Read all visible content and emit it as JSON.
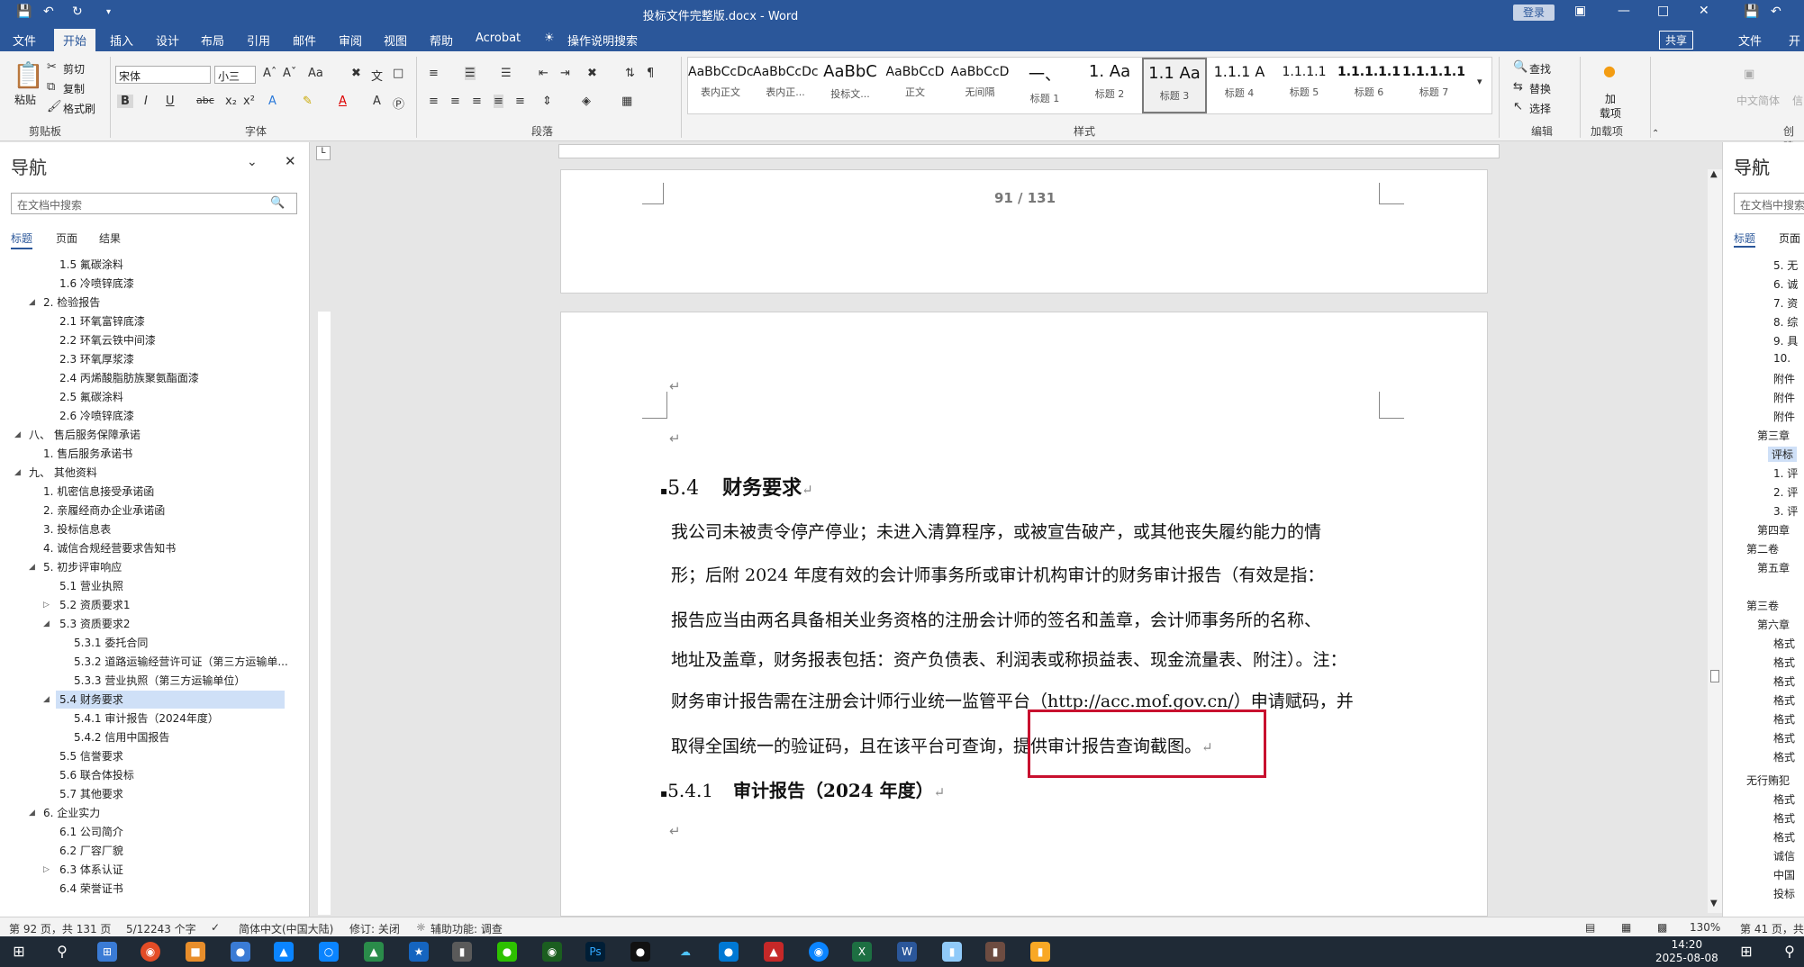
{
  "titlebar": {
    "doc_title": "投标文件完整版.docx - Word",
    "login": "登录",
    "save_icon": "save-icon",
    "undo_icon": "undo-icon",
    "redo_icon": "redo-icon"
  },
  "tabs": [
    "文件",
    "开始",
    "插入",
    "设计",
    "布局",
    "引用",
    "邮件",
    "审阅",
    "视图",
    "帮助",
    "Acrobat",
    "操作说明搜索"
  ],
  "active_tab": "开始",
  "share": "共享",
  "right_tabs": [
    "文件",
    "开"
  ],
  "ribbon": {
    "clipboard": {
      "paste": "粘贴",
      "cut": "剪切",
      "copy": "复制",
      "format_painter": "格式刷",
      "label": "剪贴板"
    },
    "font": {
      "name": "宋体",
      "size": "小三",
      "label": "字体"
    },
    "paragraph": {
      "label": "段落"
    },
    "styles": {
      "label": "样式",
      "items": [
        {
          "sample": "AaBbCcDc",
          "name": "表内正文"
        },
        {
          "sample": "AaBbCcDc",
          "name": "表内正..."
        },
        {
          "sample": "AaBbC",
          "name": "投标文..."
        },
        {
          "sample": "AaBbCcD",
          "name": "正文"
        },
        {
          "sample": "AaBbCcD",
          "name": "无间隔"
        },
        {
          "sample": "一、",
          "name": "标题 1"
        },
        {
          "sample": "1. Aa",
          "name": "标题 2"
        },
        {
          "sample": "1.1 Aa",
          "name": "标题 3"
        },
        {
          "sample": "1.1.1 A",
          "name": "标题 4"
        },
        {
          "sample": "1.1.1.1",
          "name": "标题 5"
        },
        {
          "sample": "1.1.1.1.1",
          "name": "标题 6"
        },
        {
          "sample": "1.1.1.1.1",
          "name": "标题 7"
        }
      ],
      "selected": "标题 3"
    },
    "editing": {
      "find": "查找",
      "replace": "替换",
      "select": "选择",
      "label": "编辑"
    },
    "addin": {
      "name1": "加",
      "name2": "载项",
      "label": "加载项"
    },
    "right_partial": {
      "label1": "中文简体",
      "label2": "信",
      "label3": "创建"
    }
  },
  "nav": {
    "title": "导航",
    "search_placeholder": "在文档中搜索",
    "subtabs": [
      "标题",
      "页面",
      "结果"
    ],
    "items": [
      {
        "text": "1.5 氟碳涂料",
        "level": 2
      },
      {
        "text": "1.6 冷喷锌底漆",
        "level": 2
      },
      {
        "text": "2. 检验报告",
        "level": 1
      },
      {
        "text": "2.1 环氧富锌底漆",
        "level": 2
      },
      {
        "text": "2.2 环氧云铁中间漆",
        "level": 2
      },
      {
        "text": "2.3 环氧厚浆漆",
        "level": 2
      },
      {
        "text": "2.4 丙烯酸脂肪族聚氨酯面漆",
        "level": 2
      },
      {
        "text": "2.5 氟碳涂料",
        "level": 2
      },
      {
        "text": "2.6 冷喷锌底漆",
        "level": 2
      },
      {
        "text": "八、 售后服务保障承诺",
        "level": 0
      },
      {
        "text": "1. 售后服务承诺书",
        "level": 1
      },
      {
        "text": "九、 其他资料",
        "level": 0
      },
      {
        "text": "1. 机密信息接受承诺函",
        "level": 1
      },
      {
        "text": "2. 亲履经商办企业承诺函",
        "level": 1
      },
      {
        "text": "3. 投标信息表",
        "level": 1
      },
      {
        "text": "4. 诚信合规经营要求告知书",
        "level": 1
      },
      {
        "text": "5. 初步评审响应",
        "level": 1
      },
      {
        "text": "5.1 营业执照",
        "level": 2
      },
      {
        "text": "5.2 资质要求1",
        "level": 2
      },
      {
        "text": "5.3 资质要求2",
        "level": 2
      },
      {
        "text": "5.3.1 委托合同",
        "level": 3
      },
      {
        "text": "5.3.2 道路运输经营许可证（第三方运输单...",
        "level": 3
      },
      {
        "text": "5.3.3 营业执照（第三方运输单位）",
        "level": 3
      },
      {
        "text": "5.4 财务要求",
        "level": 2,
        "selected": true
      },
      {
        "text": "5.4.1 审计报告（2024年度）",
        "level": 3
      },
      {
        "text": "5.4.2 信用中国报告",
        "level": 3
      },
      {
        "text": "5.5 信誉要求",
        "level": 2
      },
      {
        "text": "5.6 联合体投标",
        "level": 2
      },
      {
        "text": "5.7 其他要求",
        "level": 2
      },
      {
        "text": "6. 企业实力",
        "level": 1
      },
      {
        "text": "6.1 公司简介",
        "level": 2
      },
      {
        "text": "6.2 厂容厂貌",
        "level": 2
      },
      {
        "text": "6.3 体系认证",
        "level": 2
      },
      {
        "text": "6.4 荣誉证书",
        "level": 2
      }
    ]
  },
  "document": {
    "page_header": "91 / 131",
    "heading1": "5.4",
    "heading1_text": "财务要求",
    "paragraph_lines": [
      "我公司未被责令停产停业；未进入清算程序，或被宣告破产，或其他丧失履约能力的情",
      "形；后附 2024 年度有效的会计师事务所或审计机构审计的财务审计报告（有效是指：",
      "报告应当由两名具备相关业务资格的注册会计师的签名和盖章，会计师事务所的名称、",
      "地址及盖章，财务报表包括：资产负债表、利润表或称损益表、现金流量表、附注）。注：",
      "财务审计报告需在注册会计师行业统一监管平台（http://acc.mof.gov.cn/）申请赋码，并",
      "取得全国统一的验证码，且在该平台可查询，提供审计报告查询截图。"
    ],
    "heading2": "5.4.1",
    "heading2_text": "审计报告（2024 年度）",
    "para_mark": "↵"
  },
  "right_pane": {
    "title": "导航",
    "search_placeholder": "在文档中搜索",
    "subtabs": [
      "标题",
      "页面"
    ],
    "items": [
      "5. 无",
      "6. 诚",
      "7. 资",
      "8. 综",
      "9. 具",
      "10.",
      "附件",
      "附件",
      "附件",
      "第三章",
      "评标",
      "1. 评",
      "2. 评",
      "3. 评",
      "第四章",
      "第二卷",
      "第五章",
      "第三卷",
      "第六章",
      "格式",
      "格式",
      "格式",
      "格式",
      "格式",
      "格式",
      "格式",
      "无行贿犯",
      "格式",
      "格式",
      "格式",
      "诚信",
      "中国",
      "投标"
    ]
  },
  "status": {
    "page": "第 92 页，共 131 页",
    "words": "5/12243 个字",
    "lang": "简体中文(中国大陆)",
    "track": "修订: 关闭",
    "access": "辅助功能: 调查",
    "zoom": "130%",
    "right_page": "第 41 页，共"
  },
  "taskbar": {
    "time": "14:20",
    "date": "2025-08-08"
  }
}
